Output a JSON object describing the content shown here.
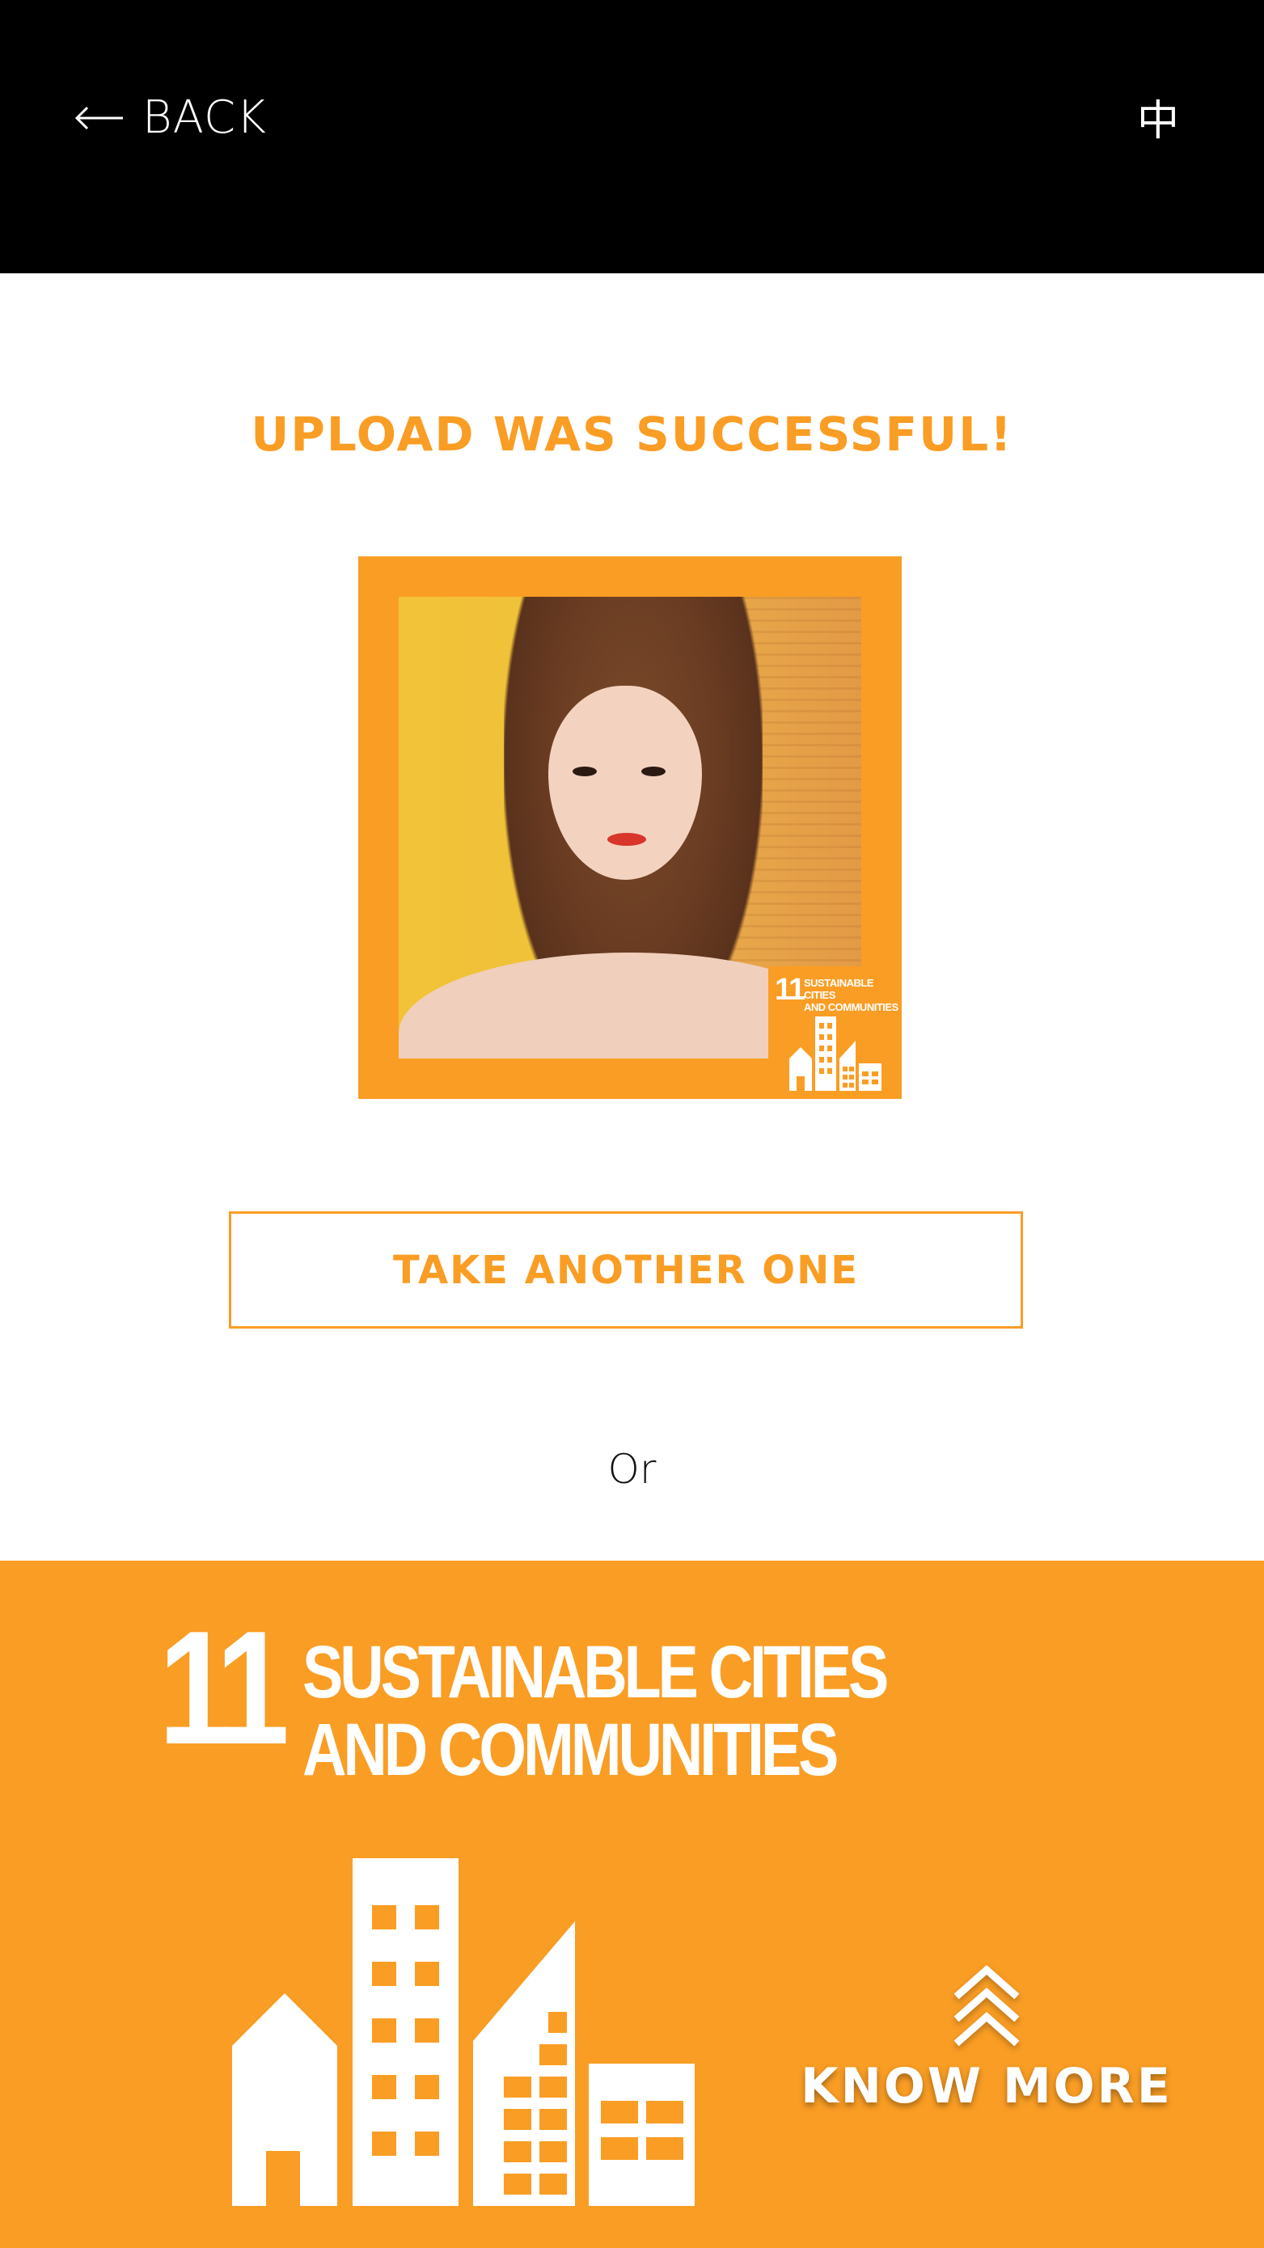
{
  "header": {
    "back_label": "BACK",
    "back_icon": "arrow-left-icon",
    "language_label": "中"
  },
  "main": {
    "title": "UPLOAD WAS SUCCESSFUL!",
    "photo_badge": {
      "number": "11",
      "line1": "SUSTAINABLE CITIES",
      "line2": "AND COMMUNITIES",
      "icon": "city-buildings-icon"
    },
    "take_another_label": "TAKE ANOTHER ONE",
    "or_label": "Or"
  },
  "sdg": {
    "number": "11",
    "title_line1": "SUSTAINABLE CITIES",
    "title_line2": "AND COMMUNITIES",
    "icon": "city-buildings-icon",
    "know_more_label": "KNOW MORE",
    "know_more_icon": "double-chevron-up-icon"
  },
  "colors": {
    "accent": "#fa9d24",
    "header_bg": "#000000",
    "background": "#ffffff"
  }
}
